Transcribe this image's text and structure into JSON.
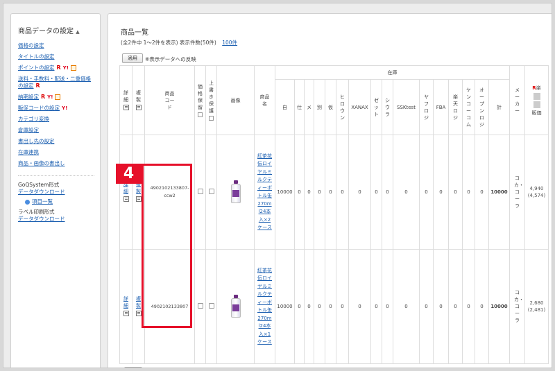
{
  "sidebar": {
    "title": "商品データの設定",
    "title_caret": "▲",
    "links": [
      "価格の設定",
      "タイトルの設定",
      "ポイントの設定",
      "送料・手数料・配送・二重価格の設定",
      "納期設定",
      "販促コードの設定",
      "カテゴリ変換",
      "倉庫設定",
      "書出し先の設定",
      "在庫連携",
      "商品・画像の書出し"
    ],
    "goq_label": "GoQSystem形式",
    "goq_download": "データダウンロード",
    "item_list": "項目一覧",
    "label_format": "ラベル印刷形式",
    "label_download": "データダウンロード",
    "icon_r": "R",
    "icon_y": "Y!"
  },
  "main": {
    "title": "商品一覧",
    "summary": "(全2件中 1〜2件を表示) 表示件数(50件)",
    "per_page_link": "100件",
    "apply_button": "適用",
    "apply_note": "※表示データへの反映"
  },
  "table": {
    "headers": {
      "detail": "詳細",
      "copy": "複製",
      "code": "商品コード",
      "price_keep": "価格保留",
      "overwrite_keep": "上書き保護",
      "image": "画像",
      "name": "商品名",
      "stock_group": "在庫",
      "maker": "メーカー",
      "rakuten": "楽",
      "rakuten_sub": "販価"
    },
    "stock_cols": [
      "自",
      "仕",
      "メ",
      "別",
      "仮",
      "ヒロウン",
      "XANAX",
      "ゼット",
      "シウラ",
      "SSKtest",
      "ヤフロジ",
      "FBA",
      "楽天ロジ",
      "ケンコーコム",
      "オープンロジ",
      "計"
    ],
    "detail_label": "詳細",
    "copy_label": "複製",
    "rows": [
      {
        "code": "4902102133807-ccw2",
        "name": "紅茶花伝ロイヤルミルクティーボトル缶270ml24本入×2ケース",
        "stock": [
          "10000",
          "0",
          "0",
          "0",
          "0",
          "0",
          "0",
          "0",
          "0",
          "0",
          "0",
          "0",
          "0",
          "0",
          "0",
          "10000"
        ],
        "maker": "コカ・コーラ",
        "price": "4,940",
        "price_sub": "(4,574)"
      },
      {
        "code": "4902102133807",
        "name": "紅茶花伝ロイヤルミルクティーボトル缶270ml24本入×1ケース",
        "stock": [
          "10000",
          "0",
          "0",
          "0",
          "0",
          "0",
          "0",
          "0",
          "0",
          "0",
          "0",
          "0",
          "0",
          "0",
          "0",
          "10000"
        ],
        "maker": "コカ・コーラ",
        "price": "2,680",
        "price_sub": "(2,481)"
      }
    ]
  },
  "annotation": {
    "step_number": "4",
    "color": "#e6102a"
  }
}
